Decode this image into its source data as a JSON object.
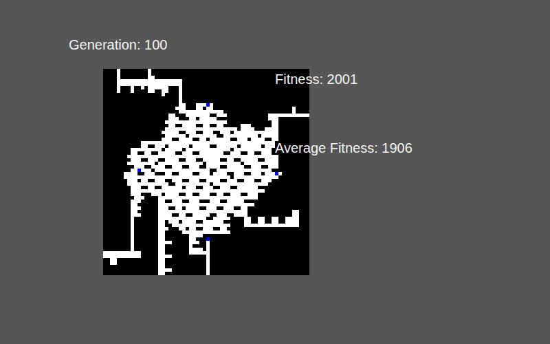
{
  "generation": "Generation: 100",
  "fitness": "Fitness: 2001",
  "average_fitness": "Average Fitness: 1906",
  "grid": {
    "rows": [
      [
        [
          4,
          4
        ],
        [
          13,
          13
        ]
      ],
      [
        [
          4,
          4
        ],
        [
          13,
          13
        ]
      ],
      [
        [
          4,
          4
        ],
        [
          13,
          14
        ]
      ],
      [
        [
          4,
          22
        ]
      ],
      [
        [
          4,
          22
        ]
      ],
      [
        [
          4,
          4
        ],
        [
          8,
          8
        ],
        [
          11,
          11
        ],
        [
          13,
          18
        ],
        [
          22,
          22
        ]
      ],
      [
        [
          4,
          4
        ],
        [
          8,
          8
        ],
        [
          13,
          14
        ],
        [
          17,
          18
        ],
        [
          22,
          22
        ]
      ],
      [
        [
          17,
          17
        ],
        [
          22,
          22
        ]
      ],
      [
        [
          22,
          22
        ]
      ],
      [
        [
          22,
          22
        ]
      ],
      [
        [
          22,
          23
        ],
        [
          27,
          31
        ]
      ],
      [
        [
          21,
          23
        ],
        [
          27,
          28
        ],
        [
          30,
          31
        ],
        [
          55,
          55
        ]
      ],
      [
        [
          22,
          34
        ],
        [
          55,
          55
        ]
      ],
      [
        [
          19,
          20
        ],
        [
          24,
          30
        ],
        [
          33,
          35
        ],
        [
          48,
          59
        ]
      ],
      [
        [
          19,
          21
        ],
        [
          25,
          26
        ],
        [
          28,
          32
        ],
        [
          48,
          50
        ]
      ],
      [
        [
          18,
          35
        ],
        [
          49,
          50
        ]
      ],
      [
        [
          19,
          20
        ],
        [
          23,
          26
        ],
        [
          29,
          30
        ],
        [
          33,
          34
        ],
        [
          40,
          42
        ],
        [
          49,
          50
        ]
      ],
      [
        [
          18,
          38
        ],
        [
          40,
          43
        ],
        [
          47,
          50
        ]
      ],
      [
        [
          17,
          21
        ],
        [
          24,
          26
        ],
        [
          29,
          31
        ],
        [
          34,
          36
        ],
        [
          38,
          50
        ]
      ],
      [
        [
          18,
          23
        ],
        [
          25,
          32
        ],
        [
          35,
          44
        ],
        [
          46,
          50
        ]
      ],
      [
        [
          17,
          19
        ],
        [
          22,
          25
        ],
        [
          28,
          29
        ],
        [
          31,
          36
        ],
        [
          39,
          41
        ],
        [
          43,
          46
        ],
        [
          49,
          50
        ]
      ],
      [
        [
          11,
          49
        ]
      ],
      [
        [
          11,
          12
        ],
        [
          15,
          17
        ],
        [
          19,
          24
        ],
        [
          26,
          30
        ],
        [
          33,
          38
        ],
        [
          40,
          45
        ],
        [
          47,
          49
        ]
      ],
      [
        [
          8,
          16
        ],
        [
          18,
          22
        ],
        [
          24,
          36
        ],
        [
          38,
          48
        ]
      ],
      [
        [
          8,
          9
        ],
        [
          12,
          13
        ],
        [
          16,
          20
        ],
        [
          23,
          25
        ],
        [
          28,
          34
        ],
        [
          37,
          39
        ],
        [
          42,
          43
        ],
        [
          46,
          48
        ]
      ],
      [
        [
          7,
          50
        ]
      ],
      [
        [
          8,
          10
        ],
        [
          13,
          15
        ],
        [
          18,
          21
        ],
        [
          24,
          26
        ],
        [
          29,
          33
        ],
        [
          36,
          37
        ],
        [
          40,
          44
        ],
        [
          47,
          50
        ]
      ],
      [
        [
          7,
          14
        ],
        [
          16,
          28
        ],
        [
          30,
          39
        ],
        [
          41,
          50
        ]
      ],
      [
        [
          9,
          11
        ],
        [
          14,
          17
        ],
        [
          20,
          22
        ],
        [
          25,
          27
        ],
        [
          30,
          33
        ],
        [
          36,
          40
        ],
        [
          43,
          45
        ],
        [
          48,
          50
        ]
      ],
      [
        [
          8,
          13
        ],
        [
          15,
          30
        ],
        [
          33,
          48
        ]
      ],
      [
        [
          6,
          9
        ],
        [
          12,
          14
        ],
        [
          18,
          19
        ],
        [
          22,
          25
        ],
        [
          28,
          30
        ],
        [
          32,
          35
        ],
        [
          38,
          40
        ],
        [
          43,
          45
        ],
        [
          47,
          51
        ]
      ],
      [
        [
          6,
          36
        ],
        [
          38,
          50
        ]
      ],
      [
        [
          7,
          9
        ],
        [
          11,
          12
        ],
        [
          15,
          17
        ],
        [
          20,
          22
        ],
        [
          25,
          27
        ],
        [
          30,
          33
        ],
        [
          36,
          38
        ],
        [
          41,
          43
        ],
        [
          46,
          48
        ]
      ],
      [
        [
          7,
          18
        ],
        [
          21,
          30
        ],
        [
          32,
          47
        ]
      ],
      [
        [
          8,
          10
        ],
        [
          13,
          14
        ],
        [
          17,
          22
        ],
        [
          24,
          26
        ],
        [
          29,
          31
        ],
        [
          34,
          36
        ],
        [
          39,
          44
        ]
      ],
      [
        [
          8,
          46
        ]
      ],
      [
        [
          8,
          10
        ],
        [
          14,
          16
        ],
        [
          18,
          21
        ],
        [
          24,
          25
        ],
        [
          28,
          30
        ],
        [
          33,
          34
        ],
        [
          37,
          39
        ],
        [
          42,
          44
        ]
      ],
      [
        [
          9,
          11
        ],
        [
          16,
          44
        ]
      ],
      [
        [
          8,
          10
        ],
        [
          16,
          17
        ],
        [
          20,
          22
        ],
        [
          25,
          27
        ],
        [
          31,
          33
        ],
        [
          36,
          40
        ]
      ],
      [
        [
          8,
          9
        ],
        [
          16,
          43
        ]
      ],
      [
        [
          8,
          10
        ],
        [
          16,
          18
        ],
        [
          21,
          22
        ],
        [
          24,
          27
        ],
        [
          30,
          32
        ],
        [
          35,
          37
        ],
        [
          40,
          41
        ]
      ],
      [
        [
          8,
          9
        ],
        [
          16,
          41
        ],
        [
          55,
          56
        ]
      ],
      [
        [
          8,
          10
        ],
        [
          16,
          19
        ],
        [
          22,
          23
        ],
        [
          26,
          30
        ],
        [
          33,
          35
        ],
        [
          38,
          41
        ],
        [
          55,
          56
        ]
      ],
      [
        [
          8,
          8
        ],
        [
          16,
          29
        ],
        [
          32,
          36
        ],
        [
          41,
          42
        ],
        [
          45,
          46
        ],
        [
          49,
          50
        ],
        [
          53,
          56
        ]
      ],
      [
        [
          8,
          8
        ],
        [
          16,
          17
        ],
        [
          19,
          21
        ],
        [
          23,
          26
        ],
        [
          29,
          34
        ],
        [
          41,
          42
        ],
        [
          45,
          46
        ],
        [
          49,
          50
        ],
        [
          53,
          56
        ]
      ],
      [
        [
          8,
          8
        ],
        [
          16,
          17
        ],
        [
          20,
          36
        ],
        [
          41,
          56
        ]
      ],
      [
        [
          8,
          8
        ],
        [
          16,
          18
        ],
        [
          22,
          23
        ],
        [
          25,
          26
        ],
        [
          29,
          31
        ],
        [
          34,
          35
        ]
      ],
      [
        [
          8,
          8
        ],
        [
          16,
          17
        ],
        [
          23,
          36
        ]
      ],
      [
        [
          8,
          8
        ],
        [
          16,
          17
        ],
        [
          25,
          28
        ]
      ],
      [
        [
          8,
          8
        ],
        [
          16,
          17
        ],
        [
          25,
          26
        ],
        [
          30,
          30
        ]
      ],
      [
        [
          8,
          8
        ],
        [
          16,
          19
        ],
        [
          25,
          27
        ],
        [
          30,
          30
        ]
      ],
      [
        [
          8,
          8
        ],
        [
          16,
          17
        ],
        [
          25,
          25
        ],
        [
          30,
          30
        ]
      ],
      [
        [
          8,
          8
        ],
        [
          16,
          17
        ],
        [
          25,
          28
        ],
        [
          30,
          30
        ]
      ],
      [
        [
          0,
          10
        ],
        [
          16,
          17
        ],
        [
          25,
          30
        ]
      ],
      [
        [
          0,
          10
        ],
        [
          16,
          19
        ],
        [
          30,
          30
        ]
      ],
      [
        [
          2,
          3
        ],
        [
          16,
          17
        ],
        [
          30,
          30
        ]
      ],
      [
        [
          2,
          3
        ],
        [
          16,
          17
        ],
        [
          30,
          30
        ]
      ],
      [
        [
          16,
          17
        ],
        [
          30,
          30
        ]
      ],
      [
        [
          16,
          19
        ],
        [
          30,
          30
        ]
      ],
      [
        [
          16,
          17
        ],
        [
          30,
          30
        ]
      ]
    ],
    "markers": [
      {
        "row": 10,
        "col": 30
      },
      {
        "row": 29,
        "col": 10
      },
      {
        "row": 30,
        "col": 50
      },
      {
        "row": 49,
        "col": 30
      }
    ]
  }
}
